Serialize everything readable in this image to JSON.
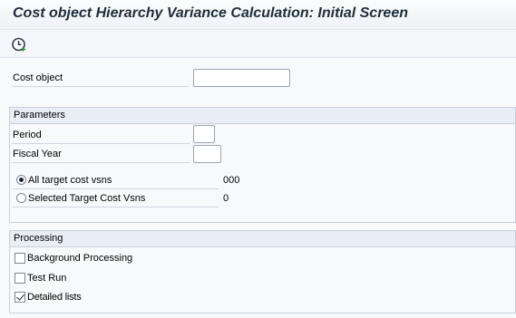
{
  "window": {
    "title": "Cost object Hierarchy Variance Calculation: Initial Screen"
  },
  "toolbar": {
    "execute_icon": "execute-clock-icon"
  },
  "fields": {
    "cost_object_label": "Cost object",
    "cost_object_value": ""
  },
  "parameters": {
    "group_title": "Parameters",
    "period_label": "Period",
    "period_value": "",
    "fiscal_year_label": "Fiscal Year",
    "fiscal_year_value": "",
    "all_target_label": "All target cost vsns",
    "all_target_value": "000",
    "all_target_selected": true,
    "selected_target_label": "Selected Target Cost Vsns",
    "selected_target_value": "0",
    "selected_target_selected": false
  },
  "processing": {
    "group_title": "Processing",
    "background_label": "Background Processing",
    "background_checked": false,
    "test_run_label": "Test Run",
    "test_run_checked": false,
    "detailed_lists_label": "Detailed lists",
    "detailed_lists_checked": true
  }
}
